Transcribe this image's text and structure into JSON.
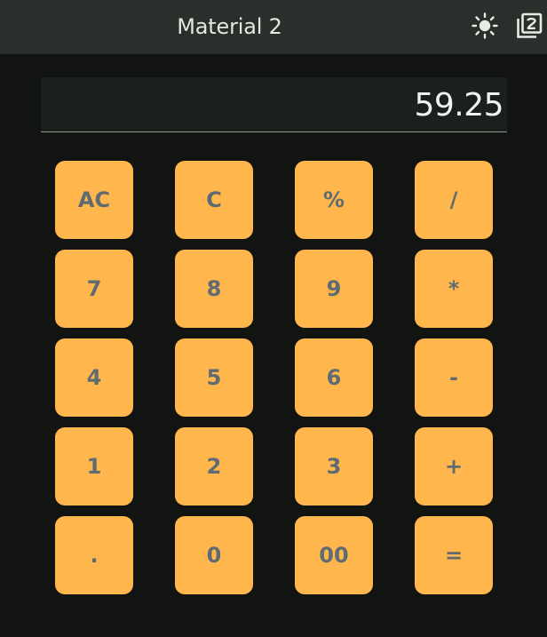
{
  "appbar": {
    "title": "Material 2",
    "theme_icon": "sun-icon",
    "variant_icon": "filter-2-icon",
    "background": "#2b2f2b"
  },
  "display": {
    "value": "59.25"
  },
  "keypad": {
    "accent": "#ffb74d",
    "rows": [
      [
        {
          "label": "AC",
          "name": "all-clear"
        },
        {
          "label": "C",
          "name": "clear"
        },
        {
          "label": "%",
          "name": "percent"
        },
        {
          "label": "/",
          "name": "divide"
        }
      ],
      [
        {
          "label": "7",
          "name": "seven"
        },
        {
          "label": "8",
          "name": "eight"
        },
        {
          "label": "9",
          "name": "nine"
        },
        {
          "label": "*",
          "name": "multiply"
        }
      ],
      [
        {
          "label": "4",
          "name": "four"
        },
        {
          "label": "5",
          "name": "five"
        },
        {
          "label": "6",
          "name": "six"
        },
        {
          "label": "-",
          "name": "subtract"
        }
      ],
      [
        {
          "label": "1",
          "name": "one"
        },
        {
          "label": "2",
          "name": "two"
        },
        {
          "label": "3",
          "name": "three"
        },
        {
          "label": "+",
          "name": "add"
        }
      ],
      [
        {
          "label": ".",
          "name": "decimal"
        },
        {
          "label": "0",
          "name": "zero"
        },
        {
          "label": "00",
          "name": "double-zero"
        },
        {
          "label": "=",
          "name": "equals"
        }
      ]
    ]
  }
}
